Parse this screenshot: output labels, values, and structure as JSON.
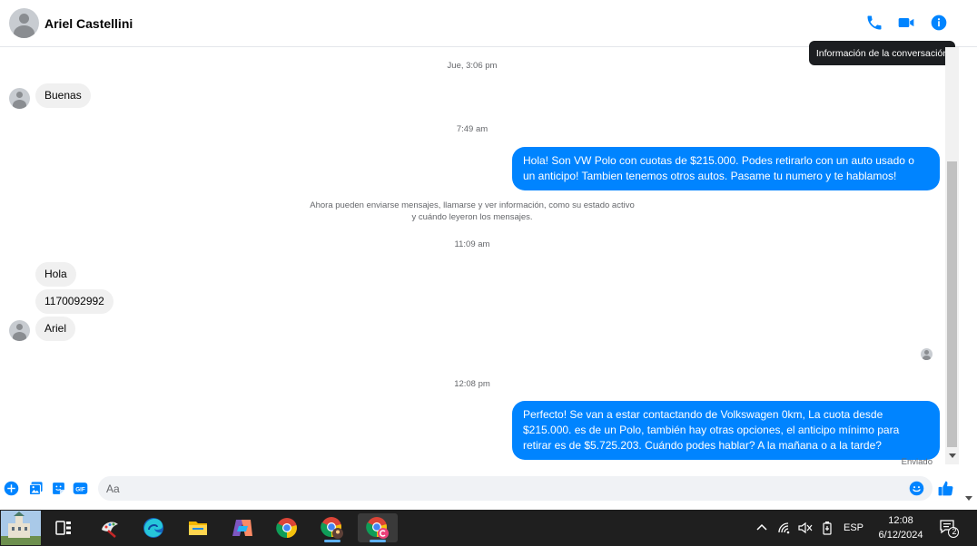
{
  "header": {
    "contact_name": "Ariel Castellini",
    "tooltip": "Información de la conversación",
    "accent": "#0084ff"
  },
  "messages": {
    "ts1": "Jue, 3:06 pm",
    "msg_buenas": "Buenas",
    "ts2": "7:49 am",
    "msg_out1": "Hola! Son VW Polo con cuotas de $215.000. Podes retirarlo con un auto usado o un anticipo! Tambien tenemos otros autos. Pasame tu numero y te hablamos!",
    "system_notice": "Ahora pueden enviarse mensajes, llamarse y ver información, como su estado activo y cuándo leyeron los mensajes.",
    "ts3": "11:09 am",
    "msg_hola": "Hola",
    "msg_number": "1170092992",
    "msg_ariel": "Ariel",
    "ts4": "12:08 pm",
    "msg_out2": "Perfecto!  Se van a estar contactando de Volkswagen 0km, La cuota desde $215.000. es de un Polo, también hay otras opciones, el anticipo mínimo para retirar es de $5.725.203. Cuándo podes hablar? A la mañana o a la tarde?",
    "status_sent": "Enviado"
  },
  "composer": {
    "placeholder": "Aa",
    "gif_label": "GIF"
  },
  "taskbar": {
    "language": "ESP",
    "time": "12:08",
    "date": "6/12/2024",
    "notifications_count": "2"
  }
}
